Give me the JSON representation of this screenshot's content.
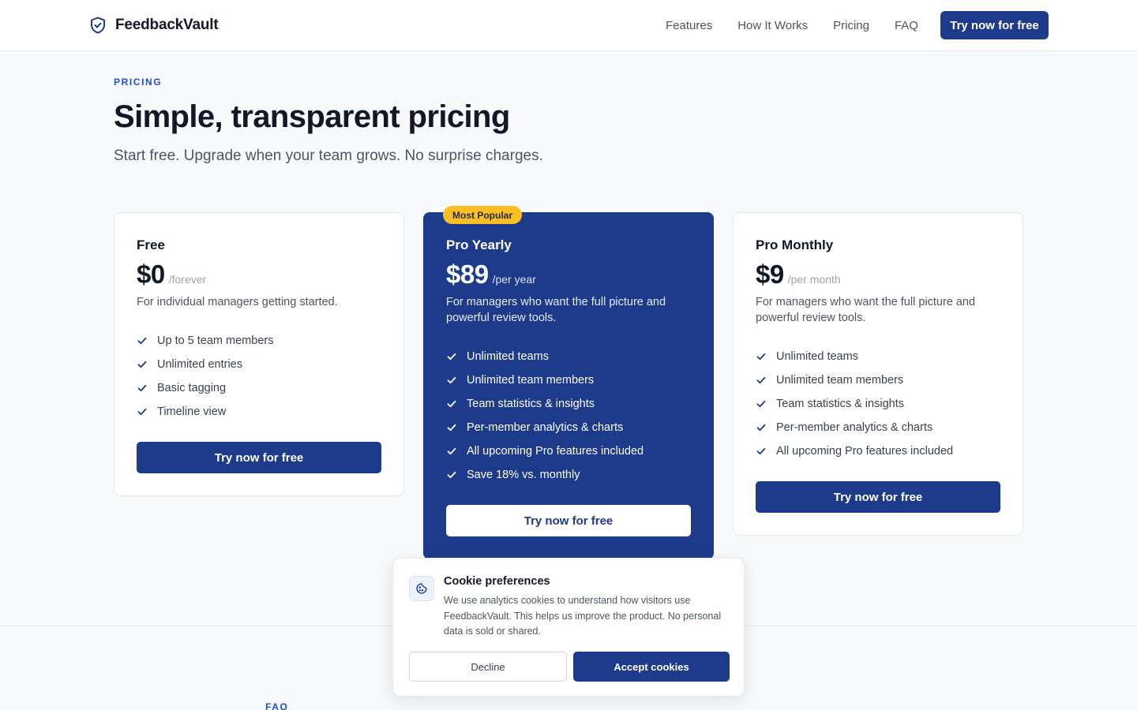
{
  "brand": {
    "name": "FeedbackVault",
    "icon": "shield-check-icon"
  },
  "nav": {
    "links": [
      "Features",
      "How It Works",
      "Pricing",
      "FAQ"
    ],
    "cta": "Try now for free"
  },
  "pricing": {
    "eyebrow": "PRICING",
    "title": "Simple, transparent pricing",
    "subtitle": "Start free. Upgrade when your team grows. No surprise charges."
  },
  "plans": [
    {
      "name": "Free",
      "price": "$0",
      "period": "/forever",
      "description": "For individual managers getting started.",
      "features": [
        "Up to 5 team members",
        "Unlimited entries",
        "Basic tagging",
        "Timeline view"
      ],
      "cta": "Try now for free"
    },
    {
      "badge": "Most Popular",
      "name": "Pro Yearly",
      "price": "$89",
      "period": "/per year",
      "description": "For managers who want the full picture and powerful review tools.",
      "features": [
        "Unlimited teams",
        "Unlimited team members",
        "Team statistics & insights",
        "Per-member analytics & charts",
        "All upcoming Pro features included",
        "Save 18% vs. monthly"
      ],
      "cta": "Try now for free"
    },
    {
      "name": "Pro Monthly",
      "price": "$9",
      "period": "/per month",
      "description": "For managers who want the full picture and powerful review tools.",
      "features": [
        "Unlimited teams",
        "Unlimited team members",
        "Team statistics & insights",
        "Per-member analytics & charts",
        "All upcoming Pro features included"
      ],
      "cta": "Try now for free"
    }
  ],
  "faq": {
    "eyebrow": "FAQ"
  },
  "cookie": {
    "icon": "cookie-icon",
    "title": "Cookie preferences",
    "text": "We use analytics cookies to understand how visitors use FeedbackVault. This helps us improve the product. No personal data is sold or shared.",
    "decline": "Decline",
    "accept": "Accept cookies"
  },
  "colors": {
    "primary": "#1e3a8a",
    "accent": "#1d4ed8",
    "badge": "#fbbf24"
  }
}
